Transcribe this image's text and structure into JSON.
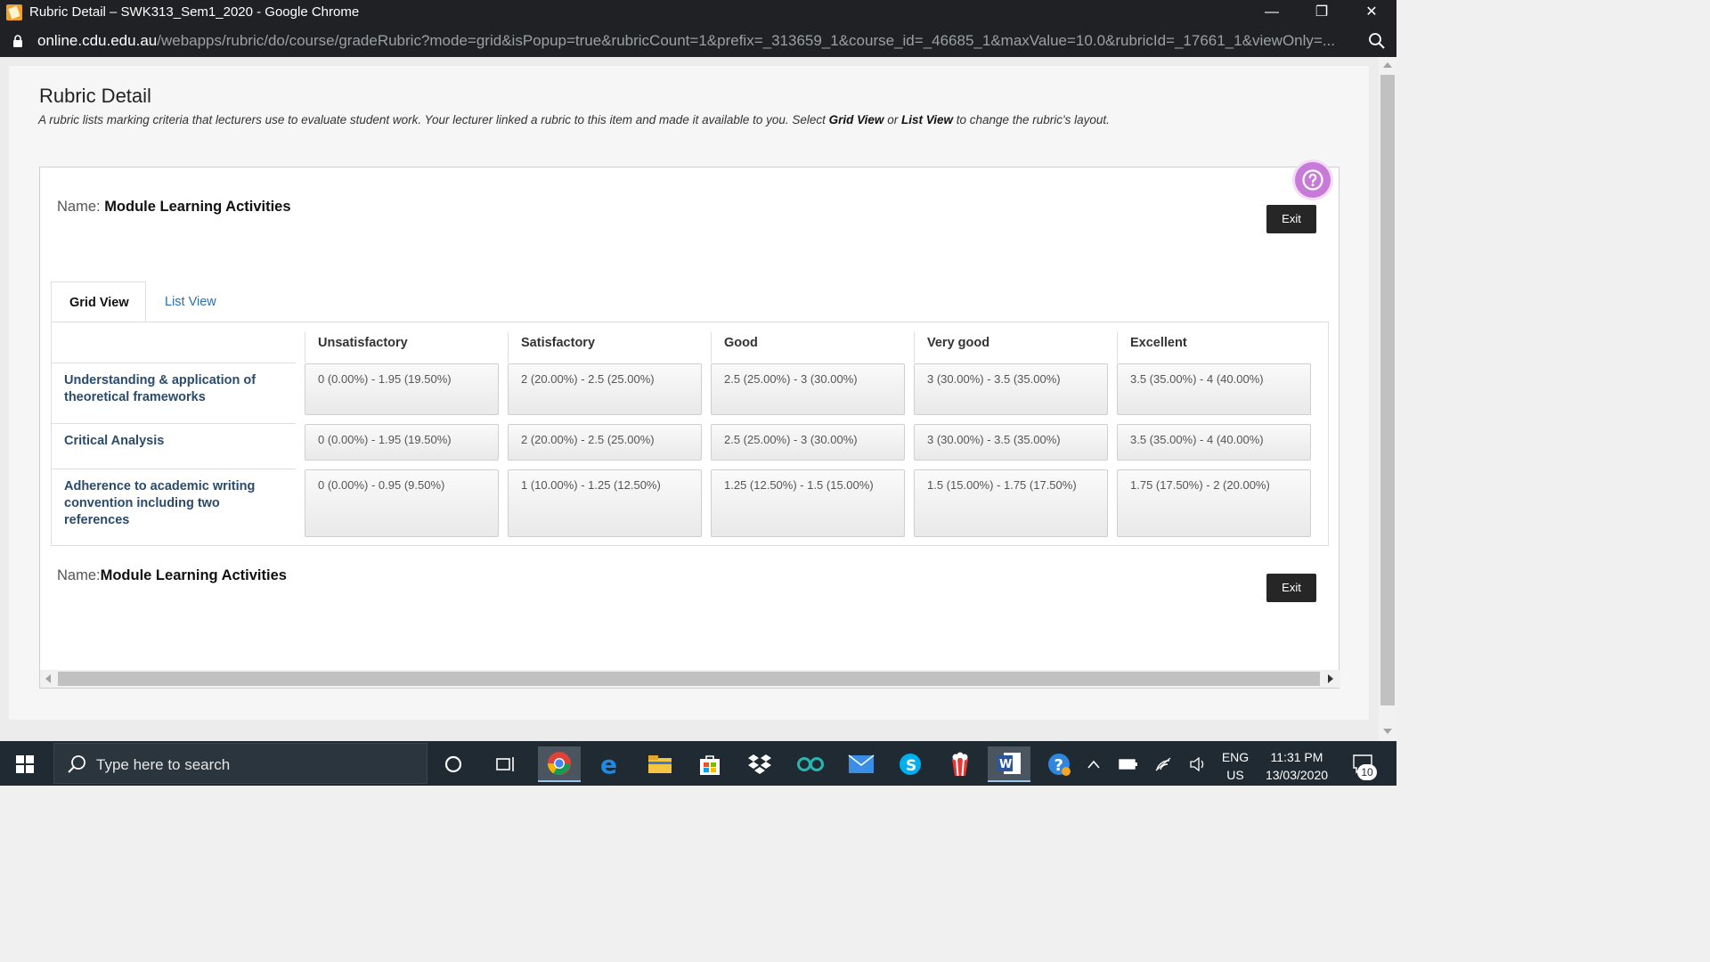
{
  "browser": {
    "window_title": "Rubric Detail – SWK313_Sem1_2020 - Google Chrome",
    "url_host": "online.cdu.edu.au",
    "url_path": "/webapps/rubric/do/course/gradeRubric?mode=grid&isPopup=true&rubricCount=1&prefix=_313659_1&course_id=_46685_1&maxValue=10.0&rubricId=_17661_1&viewOnly=...",
    "minimize": "—",
    "restore": "❐",
    "close": "✕"
  },
  "page": {
    "title": "Rubric Detail",
    "intro_before": "A rubric lists marking criteria that lecturers use to evaluate student work. Your lecturer linked a rubric to this item and made it available to you. Select ",
    "intro_grid": "Grid View",
    "intro_or": " or ",
    "intro_list": "List View",
    "intro_after": " to change the rubric's layout."
  },
  "rubric": {
    "name_label_top": "Name: ",
    "name_label_bottom": "Name:",
    "name_value": "Module Learning Activities",
    "exit_label": "Exit",
    "tabs": [
      "Grid View",
      "List View"
    ],
    "levels": [
      "Unsatisfactory",
      "Satisfactory",
      "Good",
      "Very good",
      "Excellent"
    ],
    "criteria": [
      {
        "title": "Understanding & application of theoretical frameworks",
        "cells": [
          "0 (0.00%) - 1.95 (19.50%)",
          "2 (20.00%) - 2.5 (25.00%)",
          "2.5 (25.00%) - 3 (30.00%)",
          "3 (30.00%) - 3.5 (35.00%)",
          "3.5 (35.00%) - 4 (40.00%)"
        ]
      },
      {
        "title": "Critical Analysis",
        "cells": [
          "0 (0.00%) - 1.95 (19.50%)",
          "2 (20.00%) - 2.5 (25.00%)",
          "2.5 (25.00%) - 3 (30.00%)",
          "3 (30.00%) - 3.5 (35.00%)",
          "3.5 (35.00%) - 4 (40.00%)"
        ]
      },
      {
        "title": "Adherence to academic writing convention including two references",
        "cells": [
          "0 (0.00%) - 0.95 (9.50%)",
          "1 (10.00%) - 1.25 (12.50%)",
          "1.25 (12.50%) - 1.5 (15.00%)",
          "1.5 (15.00%) - 1.75 (17.50%)",
          "1.75 (17.50%) - 2 (20.00%)"
        ]
      }
    ]
  },
  "taskbar": {
    "search_placeholder": "Type here to search",
    "lang_top": "ENG",
    "lang_bottom": "US",
    "time": "11:31 PM",
    "date": "13/03/2020",
    "notification_count": "10"
  }
}
